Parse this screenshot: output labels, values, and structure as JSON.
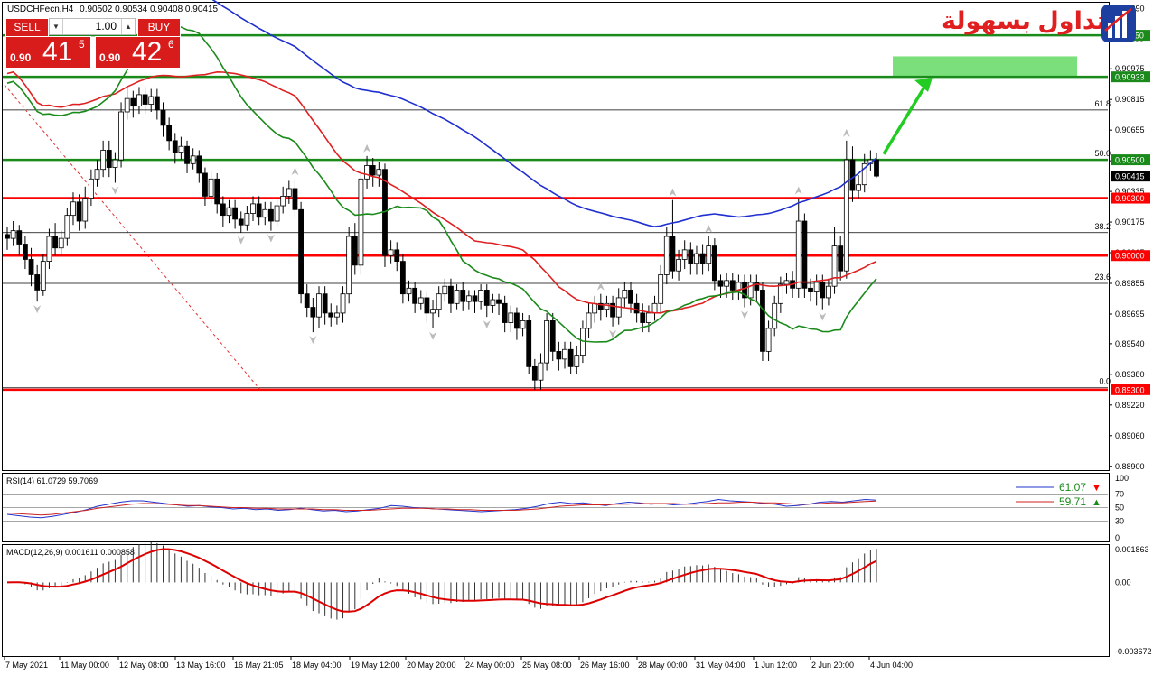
{
  "header": {
    "symbol_info": "USDCHFecn,H4",
    "ohlc": "0.90502 0.90534 0.90408 0.90415"
  },
  "trade": {
    "sell_label": "SELL",
    "buy_label": "BUY",
    "lot": "1.00",
    "sell_prefix": "0.90",
    "sell_big": "41",
    "sell_sup": "5",
    "buy_prefix": "0.90",
    "buy_big": "42",
    "buy_sup": "6"
  },
  "logo": {
    "text": "التداول بسهولة"
  },
  "colors": {
    "ma_blue": "#1f2fd0",
    "ma_red": "#e02020",
    "ma_green": "#1a8a1a",
    "level_green": "#1a8a1a",
    "level_red": "#ff0000",
    "target_zone": "#7be07b",
    "arrow": "#22cc22",
    "tag_red": "#ff0000",
    "tag_green": "#1a8a1a",
    "rsi_blue": "#2233cc",
    "rsi_red": "#cc2222",
    "macd_signal": "#dd0000"
  },
  "chart_data": [
    {
      "type": "candlestick",
      "ylim": [
        0.8888,
        0.9132
      ],
      "y_ticks": [
        "0.91290",
        "0.91135",
        "0.90975",
        "0.90815",
        "0.90655",
        "0.90495",
        "0.90335",
        "0.90175",
        "0.90015",
        "0.89855",
        "0.89695",
        "0.89540",
        "0.89380",
        "0.89220",
        "0.89060",
        "0.88900"
      ],
      "x_ticks": [
        "7 May 2021",
        "11 May 00:00",
        "12 May 08:00",
        "13 May 16:00",
        "16 May 21:05",
        "18 May 04:00",
        "19 May 12:00",
        "20 May 20:00",
        "24 May 00:00",
        "25 May 08:00",
        "26 May 16:00",
        "28 May 00:00",
        "31 May 04:00",
        "1 Jun 12:00",
        "2 Jun 20:00",
        "4 Jun 04:00"
      ],
      "current_price": "0.90415",
      "horizontal_levels": [
        {
          "price": 0.9115,
          "label": "0.91150",
          "color": "green"
        },
        {
          "price": 0.90933,
          "label": "0.90933",
          "color": "green"
        },
        {
          "price": 0.905,
          "label": "0.90500",
          "color": "green"
        },
        {
          "price": 0.903,
          "label": "0.90300",
          "color": "red"
        },
        {
          "price": 0.9,
          "label": "0.90000",
          "color": "red"
        },
        {
          "price": 0.893,
          "label": "0.89300",
          "color": "red"
        }
      ],
      "fibonacci": [
        {
          "label": "61.8",
          "price": 0.9076
        },
        {
          "label": "50.0",
          "price": 0.905
        },
        {
          "label": "38.2",
          "price": 0.9012
        },
        {
          "label": "23.6",
          "price": 0.89855
        },
        {
          "label": "0.0",
          "price": 0.8931
        }
      ],
      "target_zone": {
        "from": 0.90933,
        "to": 0.9104
      },
      "candles": [
        [
          0.9011,
          0.9009,
          0.9015,
          0.9003
        ],
        [
          0.9009,
          0.9013,
          0.9018,
          0.9005
        ],
        [
          0.9013,
          0.9006,
          0.9016,
          0.9
        ],
        [
          0.9006,
          0.8998,
          0.901,
          0.8993
        ],
        [
          0.8998,
          0.899,
          0.9004,
          0.8984
        ],
        [
          0.899,
          0.8982,
          0.8995,
          0.8976
        ],
        [
          0.8982,
          0.8997,
          0.9001,
          0.8979
        ],
        [
          0.8997,
          0.901,
          0.9014,
          0.8993
        ],
        [
          0.901,
          0.9004,
          0.9017,
          0.9
        ],
        [
          0.9004,
          0.9009,
          0.9013,
          0.9
        ],
        [
          0.9009,
          0.9021,
          0.9025,
          0.9005
        ],
        [
          0.9021,
          0.9028,
          0.9033,
          0.9016
        ],
        [
          0.9028,
          0.9018,
          0.9032,
          0.9013
        ],
        [
          0.9018,
          0.903,
          0.9036,
          0.9014
        ],
        [
          0.903,
          0.904,
          0.9045,
          0.9026
        ],
        [
          0.904,
          0.9045,
          0.905,
          0.9036
        ],
        [
          0.9045,
          0.9055,
          0.906,
          0.9041
        ],
        [
          0.9055,
          0.9046,
          0.906,
          0.9041
        ],
        [
          0.9046,
          0.905,
          0.9054,
          0.9038
        ],
        [
          0.905,
          0.9075,
          0.908,
          0.9046
        ],
        [
          0.9075,
          0.9082,
          0.9088,
          0.9071
        ],
        [
          0.9082,
          0.9078,
          0.9086,
          0.9072
        ],
        [
          0.9078,
          0.9084,
          0.9088,
          0.9074
        ],
        [
          0.9084,
          0.9079,
          0.9088,
          0.9074
        ],
        [
          0.9079,
          0.9083,
          0.9087,
          0.9075
        ],
        [
          0.9083,
          0.9076,
          0.9087,
          0.9071
        ],
        [
          0.9076,
          0.9068,
          0.908,
          0.9062
        ],
        [
          0.9068,
          0.906,
          0.9072,
          0.9055
        ],
        [
          0.906,
          0.9054,
          0.9064,
          0.9048
        ],
        [
          0.9054,
          0.9057,
          0.9062,
          0.905
        ],
        [
          0.9057,
          0.9048,
          0.906,
          0.9043
        ],
        [
          0.9048,
          0.9052,
          0.9056,
          0.9045
        ],
        [
          0.9052,
          0.9043,
          0.9055,
          0.9038
        ],
        [
          0.9043,
          0.9031,
          0.9046,
          0.9026
        ],
        [
          0.9031,
          0.904,
          0.9044,
          0.9027
        ],
        [
          0.904,
          0.9027,
          0.9043,
          0.9022
        ],
        [
          0.9027,
          0.9021,
          0.9031,
          0.9015
        ],
        [
          0.9021,
          0.9025,
          0.9029,
          0.9017
        ],
        [
          0.9025,
          0.9019,
          0.9029,
          0.9014
        ],
        [
          0.9019,
          0.9016,
          0.9023,
          0.9012
        ],
        [
          0.9016,
          0.9022,
          0.9026,
          0.9013
        ],
        [
          0.9022,
          0.9027,
          0.9031,
          0.9018
        ],
        [
          0.9027,
          0.902,
          0.9031,
          0.9016
        ],
        [
          0.902,
          0.9024,
          0.9028,
          0.9016
        ],
        [
          0.9024,
          0.9018,
          0.9028,
          0.9013
        ],
        [
          0.9018,
          0.9026,
          0.903,
          0.9015
        ],
        [
          0.9026,
          0.9031,
          0.9036,
          0.9022
        ],
        [
          0.9031,
          0.9035,
          0.9039,
          0.9027
        ],
        [
          0.9035,
          0.9024,
          0.904,
          0.902
        ],
        [
          0.9024,
          0.898,
          0.9028,
          0.8975
        ],
        [
          0.898,
          0.8973,
          0.8985,
          0.8968
        ],
        [
          0.8973,
          0.8968,
          0.8978,
          0.896
        ],
        [
          0.8968,
          0.898,
          0.8984,
          0.8962
        ],
        [
          0.898,
          0.897,
          0.8984,
          0.8964
        ],
        [
          0.897,
          0.8968,
          0.8975,
          0.8963
        ],
        [
          0.8968,
          0.897,
          0.8974,
          0.8964
        ],
        [
          0.897,
          0.898,
          0.8984,
          0.8965
        ],
        [
          0.898,
          0.901,
          0.9015,
          0.8975
        ],
        [
          0.901,
          0.8995,
          0.9017,
          0.899
        ],
        [
          0.8995,
          0.904,
          0.9045,
          0.899
        ],
        [
          0.904,
          0.9047,
          0.9052,
          0.9035
        ],
        [
          0.9047,
          0.9042,
          0.9051,
          0.9036
        ],
        [
          0.9042,
          0.9045,
          0.9049,
          0.9036
        ],
        [
          0.9045,
          0.9,
          0.9048,
          0.8994
        ],
        [
          0.9,
          0.9003,
          0.9008,
          0.8996
        ],
        [
          0.9003,
          0.8997,
          0.9007,
          0.8992
        ],
        [
          0.8997,
          0.898,
          0.9001,
          0.8975
        ],
        [
          0.898,
          0.8983,
          0.8987,
          0.8976
        ],
        [
          0.8983,
          0.8975,
          0.8986,
          0.897
        ],
        [
          0.8975,
          0.8978,
          0.8982,
          0.8972
        ],
        [
          0.8978,
          0.897,
          0.8981,
          0.8965
        ],
        [
          0.897,
          0.8972,
          0.8977,
          0.8962
        ],
        [
          0.8972,
          0.898,
          0.8984,
          0.8968
        ],
        [
          0.898,
          0.8984,
          0.8988,
          0.8976
        ],
        [
          0.8984,
          0.8975,
          0.8988,
          0.897
        ],
        [
          0.8975,
          0.8982,
          0.8985,
          0.8972
        ],
        [
          0.8982,
          0.8976,
          0.8986,
          0.8971
        ],
        [
          0.8976,
          0.8979,
          0.8982,
          0.8972
        ],
        [
          0.8979,
          0.8976,
          0.8982,
          0.897
        ],
        [
          0.8976,
          0.8982,
          0.8985,
          0.8972
        ],
        [
          0.8982,
          0.8974,
          0.8985,
          0.8968
        ],
        [
          0.8974,
          0.8977,
          0.898,
          0.897
        ],
        [
          0.8977,
          0.8975,
          0.898,
          0.8969
        ],
        [
          0.8975,
          0.8965,
          0.8979,
          0.896
        ],
        [
          0.8965,
          0.897,
          0.8974,
          0.896
        ],
        [
          0.897,
          0.8962,
          0.8973,
          0.8956
        ],
        [
          0.8962,
          0.8966,
          0.897,
          0.8958
        ],
        [
          0.8966,
          0.8942,
          0.8969,
          0.8938
        ],
        [
          0.8942,
          0.8935,
          0.8946,
          0.893
        ],
        [
          0.8935,
          0.8944,
          0.8949,
          0.893
        ],
        [
          0.8944,
          0.8966,
          0.897,
          0.894
        ],
        [
          0.8966,
          0.895,
          0.897,
          0.8945
        ],
        [
          0.895,
          0.8946,
          0.8955,
          0.894
        ],
        [
          0.8946,
          0.8951,
          0.8955,
          0.8941
        ],
        [
          0.8951,
          0.8942,
          0.8955,
          0.8938
        ],
        [
          0.8942,
          0.8948,
          0.8953,
          0.8938
        ],
        [
          0.8948,
          0.8962,
          0.8966,
          0.8944
        ],
        [
          0.8962,
          0.897,
          0.8975,
          0.8957
        ],
        [
          0.897,
          0.8975,
          0.8979,
          0.8965
        ],
        [
          0.8975,
          0.8972,
          0.898,
          0.8966
        ],
        [
          0.8972,
          0.8975,
          0.8979,
          0.8968
        ],
        [
          0.8975,
          0.8968,
          0.8979,
          0.8963
        ],
        [
          0.8968,
          0.8978,
          0.8983,
          0.8964
        ],
        [
          0.8978,
          0.8982,
          0.8986,
          0.8973
        ],
        [
          0.8982,
          0.8975,
          0.8986,
          0.897
        ],
        [
          0.8975,
          0.897,
          0.898,
          0.8965
        ],
        [
          0.897,
          0.8965,
          0.8975,
          0.896
        ],
        [
          0.8965,
          0.897,
          0.8974,
          0.896
        ],
        [
          0.897,
          0.8975,
          0.8979,
          0.8966
        ],
        [
          0.8975,
          0.899,
          0.8995,
          0.897
        ],
        [
          0.899,
          0.901,
          0.9015,
          0.8985
        ],
        [
          0.901,
          0.8992,
          0.9029,
          0.8988
        ],
        [
          0.8992,
          0.8998,
          0.9003,
          0.8987
        ],
        [
          0.8998,
          0.9003,
          0.9008,
          0.8993
        ],
        [
          0.9003,
          0.8996,
          0.9007,
          0.899
        ],
        [
          0.8996,
          0.9001,
          0.9005,
          0.899
        ],
        [
          0.9001,
          0.8996,
          0.9006,
          0.899
        ],
        [
          0.8996,
          0.9005,
          0.901,
          0.8992
        ],
        [
          0.9005,
          0.8987,
          0.9009,
          0.8982
        ],
        [
          0.8987,
          0.8984,
          0.899,
          0.8978
        ],
        [
          0.8984,
          0.8987,
          0.8991,
          0.8978
        ],
        [
          0.8987,
          0.8982,
          0.8991,
          0.8977
        ],
        [
          0.8982,
          0.8986,
          0.899,
          0.8977
        ],
        [
          0.8986,
          0.8978,
          0.899,
          0.8973
        ],
        [
          0.8978,
          0.8986,
          0.899,
          0.8974
        ],
        [
          0.8986,
          0.8982,
          0.899,
          0.8976
        ],
        [
          0.8982,
          0.895,
          0.8986,
          0.8945
        ],
        [
          0.895,
          0.8962,
          0.8966,
          0.8945
        ],
        [
          0.8962,
          0.8975,
          0.8979,
          0.8958
        ],
        [
          0.8975,
          0.8985,
          0.8989,
          0.897
        ],
        [
          0.8985,
          0.8987,
          0.8991,
          0.898
        ],
        [
          0.8987,
          0.8983,
          0.8992,
          0.8978
        ],
        [
          0.8983,
          0.9018,
          0.903,
          0.8978
        ],
        [
          0.9018,
          0.8983,
          0.9022,
          0.8978
        ],
        [
          0.8983,
          0.8981,
          0.8988,
          0.8976
        ],
        [
          0.8981,
          0.8986,
          0.899,
          0.8974
        ],
        [
          0.8986,
          0.8978,
          0.899,
          0.8972
        ],
        [
          0.8978,
          0.8984,
          0.8988,
          0.8974
        ],
        [
          0.8984,
          0.9005,
          0.9015,
          0.898
        ],
        [
          0.9005,
          0.8992,
          0.901,
          0.8987
        ],
        [
          0.8992,
          0.905,
          0.906,
          0.8988
        ],
        [
          0.905,
          0.9034,
          0.9057,
          0.9028
        ],
        [
          0.9034,
          0.9037,
          0.9042,
          0.903
        ],
        [
          0.9037,
          0.9048,
          0.9053,
          0.9033
        ],
        [
          0.9048,
          0.905,
          0.9055,
          0.9044
        ],
        [
          0.905,
          0.90415,
          0.90534,
          0.90408
        ]
      ],
      "moving_averages": {
        "blue_start": 0.917,
        "blue_end": 0.9051,
        "red_start": 0.9095,
        "red_end": 0.8997,
        "green_start": 0.909,
        "green_end": 0.8988
      }
    },
    {
      "type": "line",
      "title": "RSI(14) 61.0729 59.7069",
      "ylim": [
        0,
        100
      ],
      "y_ticks": [
        "100",
        "70",
        "50",
        "30",
        "0"
      ],
      "levels": [
        70,
        50,
        30
      ],
      "legend": [
        {
          "label": "61.07",
          "color": "#2233cc",
          "marker": "▼",
          "marker_color": "#ff0000"
        },
        {
          "label": "59.71",
          "color": "#cc2222",
          "marker": "▲",
          "marker_color": "#1a8a1a"
        }
      ],
      "series": [
        {
          "values": [
            40,
            38,
            36,
            35,
            37,
            40,
            43,
            47,
            52,
            55,
            58,
            60,
            60,
            58,
            56,
            54,
            52,
            53,
            51,
            50,
            48,
            49,
            47,
            48,
            46,
            47,
            49,
            47,
            45,
            46,
            44,
            45,
            47,
            49,
            53,
            52,
            50,
            49,
            48,
            47,
            46,
            45,
            44,
            45,
            46,
            47,
            49,
            52,
            56,
            58,
            56,
            57,
            55,
            53,
            56,
            58,
            57,
            55,
            56,
            54,
            55,
            57,
            59,
            62,
            60,
            59,
            58,
            56,
            55,
            52,
            53,
            55,
            58,
            59,
            58,
            60,
            62,
            61
          ]
        },
        {
          "values": [
            42,
            41,
            40,
            39,
            40,
            42,
            44,
            46,
            49,
            51,
            53,
            55,
            56,
            56,
            55,
            54,
            53,
            53,
            52,
            51,
            50,
            50,
            49,
            49,
            48,
            48,
            48,
            48,
            47,
            47,
            46,
            46,
            46,
            47,
            48,
            49,
            49,
            49,
            48,
            48,
            47,
            47,
            46,
            46,
            46,
            46,
            47,
            48,
            50,
            52,
            53,
            54,
            54,
            54,
            55,
            55,
            56,
            56,
            56,
            56,
            55,
            55,
            56,
            57,
            57,
            58,
            58,
            57,
            57,
            56,
            55,
            55,
            56,
            57,
            57,
            58,
            59,
            59.7
          ]
        }
      ]
    },
    {
      "type": "bar",
      "title": "MACD(12,26,9) 0.001611 0.000858",
      "ylim": [
        -0.003672,
        0.001863
      ],
      "y_ticks": [
        "0.001863",
        "0.00",
        "-0.003672"
      ],
      "signal_color": "#dd0000"
    }
  ]
}
